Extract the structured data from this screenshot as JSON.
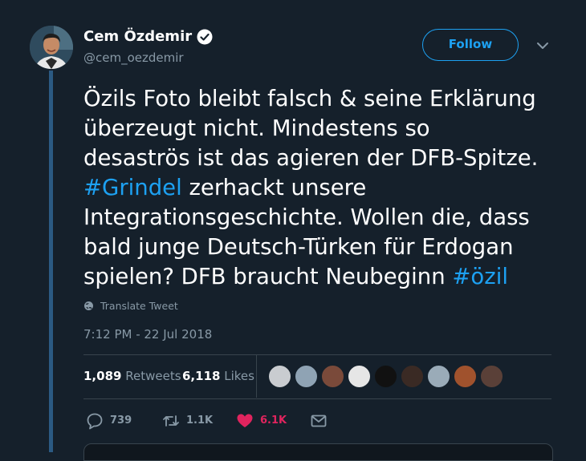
{
  "author": {
    "display_name": "Cem Özdemir",
    "handle": "@cem_oezdemir",
    "verified": true
  },
  "header": {
    "follow_label": "Follow",
    "menu_icon": "chevron-down-icon"
  },
  "tweet": {
    "lines": [
      [
        {
          "text": "Özils Foto bleibt falsch & seine Erklärung"
        }
      ],
      [
        {
          "text": "überzeugt nicht. Mindestens so"
        }
      ],
      [
        {
          "text": "desaströs ist das agieren der DFB-Spitze."
        }
      ],
      [
        {
          "text": "#Grindel",
          "hashtag": true
        },
        {
          "text": " zerhackt unsere"
        }
      ],
      [
        {
          "text": "Integrationsgeschichte. Wollen die, dass"
        }
      ],
      [
        {
          "text": "bald junge Deutsch-Türken für Erdogan"
        }
      ],
      [
        {
          "text": "spielen? DFB braucht Neubeginn "
        },
        {
          "text": "#özil",
          "hashtag": true
        }
      ]
    ],
    "translate_label": "Translate Tweet",
    "timestamp": "7:12 PM - 22 Jul 2018"
  },
  "stats": {
    "retweets_count": "1,089",
    "retweets_label": "Retweets",
    "likes_count": "6,118",
    "likes_label": "Likes"
  },
  "likers": [
    {
      "name": "liker-1",
      "color": "#c9ccd0"
    },
    {
      "name": "liker-2",
      "color": "#8fa3b4"
    },
    {
      "name": "liker-3",
      "color": "#7a4a3a"
    },
    {
      "name": "liker-4",
      "color": "#e6e6e6"
    },
    {
      "name": "liker-5",
      "color": "#111111"
    },
    {
      "name": "liker-6",
      "color": "#3a2a24"
    },
    {
      "name": "liker-7",
      "color": "#9aabb8"
    },
    {
      "name": "liker-8",
      "color": "#a0522d"
    },
    {
      "name": "liker-9",
      "color": "#5a4038"
    }
  ],
  "actions": {
    "reply_count": "739",
    "retweet_count": "1.1K",
    "like_count": "6.1K"
  },
  "colors": {
    "background": "#15202b",
    "accent": "#1da1f2",
    "like": "#e0245e",
    "muted": "#8899a6",
    "thread_line": "#2b5a83"
  }
}
